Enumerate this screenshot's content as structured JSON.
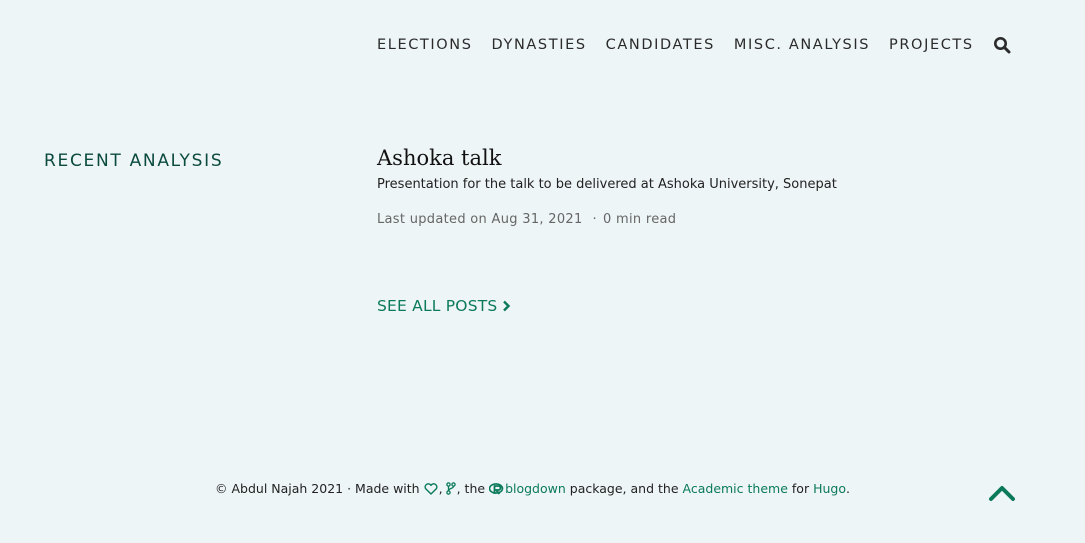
{
  "nav": {
    "items": [
      {
        "label": "ELECTIONS"
      },
      {
        "label": "DYNASTIES"
      },
      {
        "label": "CANDIDATES"
      },
      {
        "label": "MISC. ANALYSIS"
      },
      {
        "label": "PROJECTS"
      }
    ],
    "search_icon": "search-icon"
  },
  "section": {
    "title": "RECENT ANALYSIS"
  },
  "post": {
    "title": "Ashoka talk",
    "summary": "Presentation for the talk to be delivered at Ashoka University, Sonepat",
    "updated": "Last updated on Aug 31, 2021",
    "separator": "·",
    "read_time": "0 min read"
  },
  "see_all": {
    "label": "SEE ALL POSTS"
  },
  "footer": {
    "copyright": "© Abdul Najah 2021 · Made with",
    "comma": ",",
    "the1": ", the",
    "blogdown": "blogdown",
    "package_text": "package, and the",
    "academic": "Academic theme",
    "for_text": "for",
    "hugo": "Hugo",
    "period": "."
  },
  "colors": {
    "background": "#eef5f7",
    "accent": "#0b7a5a",
    "section_title": "#0b4a3f"
  }
}
